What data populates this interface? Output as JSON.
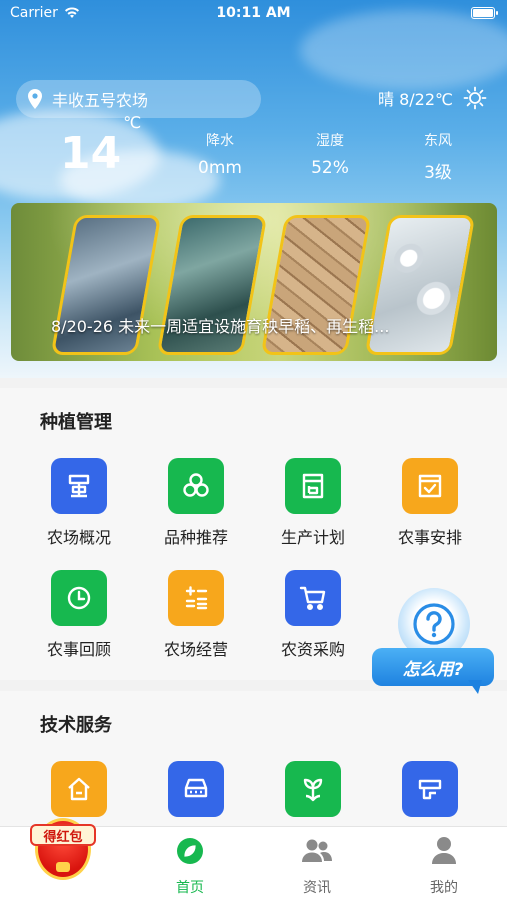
{
  "status_bar": {
    "carrier": "Carrier",
    "time": "10:11 AM"
  },
  "weather": {
    "location": "丰收五号农场",
    "summary": "晴 8/22℃",
    "temperature": "14",
    "temperature_unit": "℃",
    "stats": [
      {
        "label": "降水",
        "value": "0mm"
      },
      {
        "label": "湿度",
        "value": "52%"
      },
      {
        "label": "东风",
        "value": "3级"
      }
    ]
  },
  "banner": {
    "text": "8/20-26 未来一周适宜设施育秧早稻、再生稻..."
  },
  "planting": {
    "title": "种植管理",
    "items": [
      {
        "label": "农场概况",
        "icon": "farm-overview-icon",
        "color": "#3467e8"
      },
      {
        "label": "品种推荐",
        "icon": "variety-icon",
        "color": "#17b84f"
      },
      {
        "label": "生产计划",
        "icon": "plan-icon",
        "color": "#17b84f"
      },
      {
        "label": "农事安排",
        "icon": "schedule-icon",
        "color": "#f7a71c"
      },
      {
        "label": "农事回顾",
        "icon": "review-icon",
        "color": "#17b84f"
      },
      {
        "label": "农场经营",
        "icon": "operation-icon",
        "color": "#f7a71c"
      },
      {
        "label": "农资采购",
        "icon": "cart-icon",
        "color": "#3467e8"
      }
    ]
  },
  "tech": {
    "title": "技术服务",
    "items": [
      {
        "icon": "house-icon",
        "color": "#f7a71c"
      },
      {
        "icon": "machine-icon",
        "color": "#3467e8"
      },
      {
        "icon": "plant-icon",
        "color": "#17b84f"
      },
      {
        "icon": "irrigation-icon",
        "color": "#3467e8"
      }
    ]
  },
  "help": {
    "label": "怎么用?"
  },
  "red_packet": {
    "label": "得红包"
  },
  "tabs": [
    {
      "label": "首页",
      "active": true
    },
    {
      "label": "资讯",
      "active": false
    },
    {
      "label": "我的",
      "active": false
    }
  ]
}
